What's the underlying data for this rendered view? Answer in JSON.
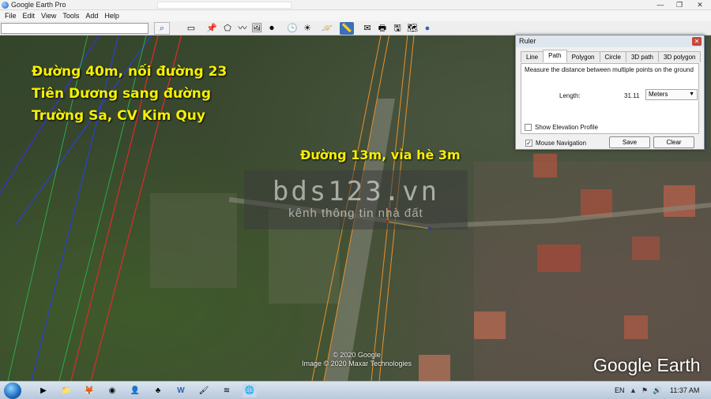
{
  "window": {
    "title": "Google Earth Pro",
    "controls": {
      "minimize": "—",
      "maximize": "❐",
      "close": "✕"
    }
  },
  "menu": {
    "items": [
      "File",
      "Edit",
      "View",
      "Tools",
      "Add",
      "Help"
    ]
  },
  "toolbar": {
    "search_value": "",
    "search_icon": "magnifier-icon",
    "buttons": [
      {
        "name": "sidebar-toggle",
        "glyph": "▭"
      },
      {
        "name": "add-placemark",
        "glyph": "📌"
      },
      {
        "name": "add-polygon",
        "glyph": "⬠"
      },
      {
        "name": "add-path",
        "glyph": "〰"
      },
      {
        "name": "add-overlay",
        "glyph": "🖼"
      },
      {
        "name": "record-tour",
        "glyph": "⏺"
      },
      {
        "name": "historical-imagery",
        "glyph": "🕒"
      },
      {
        "name": "sunlight",
        "glyph": "☀"
      },
      {
        "name": "switch-planet",
        "glyph": "🪐"
      },
      {
        "name": "ruler",
        "glyph": "📏"
      },
      {
        "name": "email",
        "glyph": "✉"
      },
      {
        "name": "print",
        "glyph": "🖶"
      },
      {
        "name": "save-image",
        "glyph": "🖫"
      },
      {
        "name": "view-in-maps",
        "glyph": "🗺"
      },
      {
        "name": "earth-view",
        "glyph": "●"
      }
    ]
  },
  "map": {
    "caption_road40": "Đường 40m, nối đường 23 Tiên Dương sang đường Trường Sa, CV Kim Quy",
    "caption_road13": "Đường 13m, vỉa hè 3m",
    "watermark_main": "bds123.vn",
    "watermark_sub": "kênh thông tin nhà đất",
    "copyright_line1": "© 2020 Google",
    "copyright_line2": "Image © 2020 Maxar Technologies",
    "logo": "Google Earth",
    "colors": {
      "caption": "#f6f000",
      "path_line": "#e8e23a",
      "orange_line": "#e8912e",
      "red_line": "#e02a2a",
      "blue_line": "#2b3fd6"
    }
  },
  "ruler": {
    "title": "Ruler",
    "tabs": [
      "Line",
      "Path",
      "Polygon",
      "Circle",
      "3D path",
      "3D polygon"
    ],
    "selected_tab": "Path",
    "description": "Measure the distance between multiple points on the ground",
    "length_label": "Length:",
    "length_value": "31.11",
    "unit": "Meters",
    "show_elevation_label": "Show Elevation Profile",
    "show_elevation_checked": false,
    "mouse_nav_label": "Mouse Navigation",
    "mouse_nav_checked": true,
    "save_label": "Save",
    "clear_label": "Clear"
  },
  "taskbar": {
    "apps": [
      {
        "name": "media-player",
        "glyph": "▶",
        "color": "#f0a020"
      },
      {
        "name": "file-explorer",
        "glyph": "📁",
        "color": "#e8c050"
      },
      {
        "name": "firefox",
        "glyph": "🦊",
        "color": "#e06020"
      },
      {
        "name": "chrome",
        "glyph": "◉",
        "color": "#3a9a40"
      },
      {
        "name": "user-app",
        "glyph": "👤",
        "color": "#a050c0"
      },
      {
        "name": "app-green",
        "glyph": "♣",
        "color": "#3aa040"
      },
      {
        "name": "word",
        "glyph": "W",
        "color": "#2b5fb0"
      },
      {
        "name": "paint",
        "glyph": "🖌",
        "color": "#e07020"
      },
      {
        "name": "app-gray",
        "glyph": "≋",
        "color": "#808890"
      },
      {
        "name": "google-earth",
        "glyph": "🌐",
        "color": "#4a80d0"
      }
    ],
    "language": "EN",
    "time": "11:37 AM"
  }
}
